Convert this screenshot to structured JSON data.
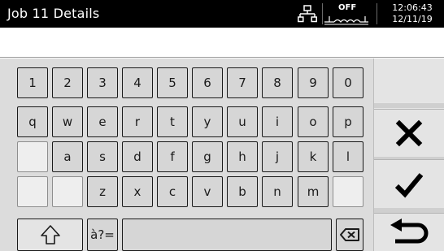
{
  "header": {
    "title": "Job 11 Details",
    "status_label": "OFF",
    "time": "12:06:43",
    "date": "12/11/19",
    "icons": [
      "network-icon",
      "wave-icon"
    ]
  },
  "input": {
    "value": ""
  },
  "keyboard": {
    "row1": [
      "1",
      "2",
      "3",
      "4",
      "5",
      "6",
      "7",
      "8",
      "9",
      "0"
    ],
    "row2": [
      "q",
      "w",
      "e",
      "r",
      "t",
      "y",
      "u",
      "i",
      "o",
      "p"
    ],
    "row3": [
      "a",
      "s",
      "d",
      "f",
      "g",
      "h",
      "j",
      "k",
      "l"
    ],
    "row4": [
      "z",
      "x",
      "c",
      "v",
      "b",
      "n",
      "m"
    ],
    "symbols_label": "à?=",
    "icons": [
      "shift-icon",
      "backspace-icon"
    ]
  },
  "side": {
    "icons": [
      "cancel-icon",
      "confirm-icon",
      "return-icon"
    ]
  },
  "colors": {
    "header_bg": "#000000",
    "key_bg": "#d6d6d6",
    "key_border": "#1a1a1a",
    "panel_bg": "#dcdcdc"
  }
}
